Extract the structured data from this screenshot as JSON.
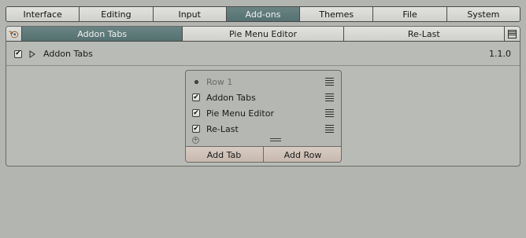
{
  "tabs": [
    "Interface",
    "Editing",
    "Input",
    "Add-ons",
    "Themes",
    "File",
    "System"
  ],
  "active_tab_index": 3,
  "subtabs": [
    "Addon Tabs",
    "Pie Menu Editor",
    "Re-Last"
  ],
  "active_subtab_index": 0,
  "addon": {
    "name": "Addon Tabs",
    "version": "1.1.0",
    "enabled": true,
    "expanded": false
  },
  "rows": [
    {
      "label": "Row 1",
      "kind": "row",
      "dim": true
    },
    {
      "label": "Addon Tabs",
      "kind": "check",
      "checked": true
    },
    {
      "label": "Pie Menu Editor",
      "kind": "check",
      "checked": true
    },
    {
      "label": "Re-Last",
      "kind": "check",
      "checked": true
    }
  ],
  "buttons": {
    "add_tab": "Add Tab",
    "add_row": "Add Row"
  },
  "icons": {
    "blender": "blender-logo-icon",
    "menu": "hamburger-menu-icon",
    "disclosure": "disclosure-triangle-icon",
    "grip": "drag-handle-icon",
    "add": "add-circle-icon"
  },
  "colors": {
    "background": "#b3b5b0",
    "active_tab": "#5f7b7b",
    "button": "#cfc0b6"
  }
}
